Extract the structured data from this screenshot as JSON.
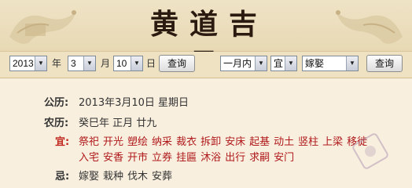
{
  "banner": {
    "title": "黄道吉日"
  },
  "controls": {
    "year": "2013",
    "year_label": "年",
    "month": "3",
    "month_label": "月",
    "day": "10",
    "day_label": "日",
    "query_label": "查询",
    "range": "一月内",
    "type": "宜",
    "activity": "嫁娶",
    "query2_label": "查询"
  },
  "info": {
    "gongli_label": "公历:",
    "gongli_value": "2013年3月10日 星期日",
    "nongli_label": "农历:",
    "nongli_value": "癸巳年 正月 廿九",
    "yi_label": "宜:",
    "yi_row1": [
      "祭祀",
      "开光",
      "塑绘",
      "纳采",
      "裁衣",
      "拆卸",
      "安床",
      "起基",
      "动土",
      "竖柱",
      "上梁",
      "移徙"
    ],
    "yi_row2": [
      "入宅",
      "安香",
      "开市",
      "立券",
      "挂匾",
      "沐浴",
      "出行",
      "求嗣",
      "安门"
    ],
    "ji_label": "忌:",
    "ji_items": [
      "嫁娶",
      "栽种",
      "伐木",
      "安葬"
    ]
  },
  "colors": {
    "accent_red": "#b0191b",
    "banner_bg": "#efe3c6",
    "content_bg": "#f8efdf"
  }
}
